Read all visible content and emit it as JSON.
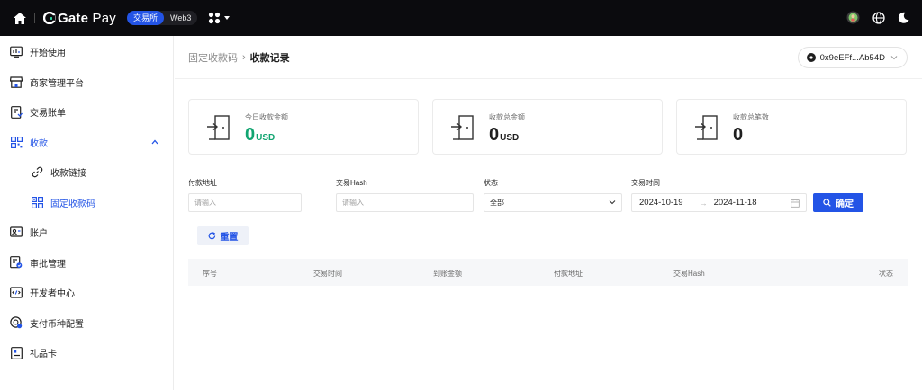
{
  "topbar": {
    "logo_text": "Gate",
    "logo_pay": "Pay",
    "switch_items": [
      "交易所",
      "Web3"
    ],
    "active_switch": "交易所"
  },
  "sidebar": {
    "items": [
      {
        "label": "开始使用",
        "icon": "getting-started-icon"
      },
      {
        "label": "商家管理平台",
        "icon": "store-icon"
      },
      {
        "label": "交易账单",
        "icon": "bill-icon"
      },
      {
        "label": "收款",
        "icon": "qr-icon",
        "expanded": true
      },
      {
        "label": "收款链接",
        "icon": "link-icon",
        "sub": true
      },
      {
        "label": "固定收款码",
        "icon": "fixed-qr-icon",
        "sub": true,
        "current": true
      },
      {
        "label": "账户",
        "icon": "account-icon"
      },
      {
        "label": "审批管理",
        "icon": "approval-icon"
      },
      {
        "label": "开发者中心",
        "icon": "code-icon"
      },
      {
        "label": "支付币种配置",
        "icon": "currency-icon"
      },
      {
        "label": "礼品卡",
        "icon": "gift-card-icon"
      }
    ]
  },
  "breadcrumb": {
    "prev": "固定收款码",
    "sep": "›",
    "current": "收款记录"
  },
  "wallet": {
    "address": "0x9eEFf...Ab54D"
  },
  "cards": [
    {
      "label": "今日收款金额",
      "value": "0",
      "unit": "USD",
      "color": "#12a571"
    },
    {
      "label": "收款总金额",
      "value": "0",
      "unit": "USD",
      "color": "#1f1f1f"
    },
    {
      "label": "收款总笔数",
      "value": "0",
      "unit": "",
      "color": "#1f1f1f"
    }
  ],
  "filters": {
    "payer_label": "付款地址",
    "payer_placeholder": "请输入",
    "hash_label": "交易Hash",
    "hash_placeholder": "请输入",
    "status_label": "状态",
    "status_value": "全部",
    "time_label": "交易时间",
    "date_start": "2024-10-19",
    "date_arrow": "→",
    "date_end": "2024-11-18",
    "confirm_label": "确定",
    "reset_label": "重置"
  },
  "table": {
    "columns": [
      "序号",
      "交易时间",
      "到账金额",
      "付款地址",
      "交易Hash",
      "状态"
    ]
  },
  "colors": {
    "accent": "#2354e6",
    "topbar_bg": "#0b0b0e",
    "positive": "#12a571"
  }
}
